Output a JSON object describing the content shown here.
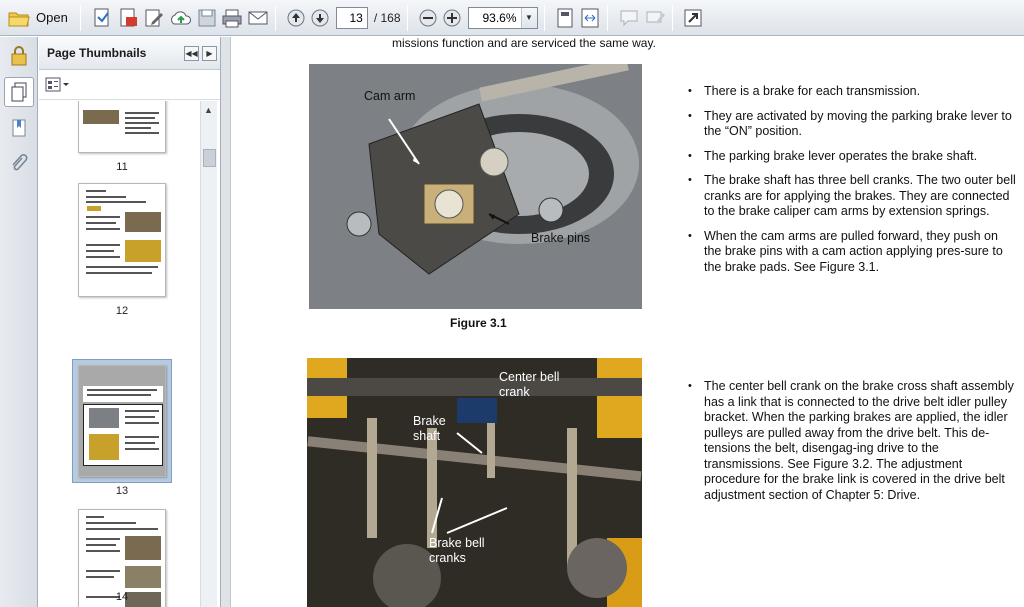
{
  "toolbar": {
    "open_label": "Open",
    "page_current": "13",
    "page_total": "/ 168",
    "zoom": "93.6%"
  },
  "panel": {
    "title": "Page Thumbnails",
    "thumbnails": [
      {
        "label": "11"
      },
      {
        "label": "12"
      },
      {
        "label": "13"
      },
      {
        "label": "14"
      }
    ]
  },
  "document": {
    "top_line": "missions function and are serviced the same way.",
    "figure1": {
      "caption": "Figure 3.1",
      "callouts": [
        "Cam arm",
        "Brake pins"
      ]
    },
    "figure2": {
      "callouts": [
        "Center bell crank",
        "Brake shaft",
        "Brake bell cranks"
      ]
    },
    "bullets1": [
      "There is a brake for each transmission.",
      "They are activated by moving the parking brake lever to the “ON” position.",
      "The parking brake lever operates the brake shaft.",
      "The brake shaft has three bell cranks. The two outer bell cranks are for applying the brakes. They are connected to the brake caliper cam arms by extension springs.",
      "When the cam arms are pulled forward, they push on the brake pins with a cam action applying pres-sure to the brake pads. See Figure 3.1."
    ],
    "bullets2": [
      "The center bell crank on the brake cross shaft assembly has a link that is connected to the drive belt idler pulley bracket. When the parking brakes are applied, the idler pulleys are pulled away from the drive belt. This de-tensions the belt, disengag-ing drive to the transmissions. See Figure 3.2. The adjustment procedure for the brake link is covered in the drive belt adjustment section of Chapter 5: Drive."
    ]
  },
  "colors": {
    "toolbar_top": "#f4f6f9",
    "toolbar_bottom": "#dde3ea",
    "selection": "#b7cbe0",
    "figure_yellow": "#e0a81e"
  }
}
